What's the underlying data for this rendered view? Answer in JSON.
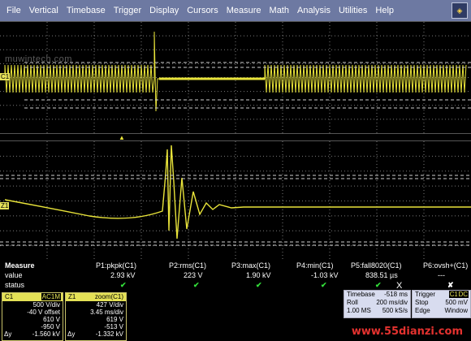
{
  "menu": [
    "File",
    "Vertical",
    "Timebase",
    "Trigger",
    "Display",
    "Cursors",
    "Measure",
    "Math",
    "Analysis",
    "Utilities",
    "Help"
  ],
  "watermark": "muwintech.com",
  "channels": {
    "c1_label": "C1",
    "z1_label": "Z1",
    "trigger_marker": "▲"
  },
  "measure": {
    "title": "Measure",
    "row_labels": [
      "value",
      "status"
    ],
    "params": [
      {
        "name": "P1:pkpk(C1)",
        "value": "2.93 kV",
        "status": "✔"
      },
      {
        "name": "P2:rms(C1)",
        "value": "223 V",
        "status": "✔"
      },
      {
        "name": "P3:max(C1)",
        "value": "1.90 kV",
        "status": "✔"
      },
      {
        "name": "P4:min(C1)",
        "value": "-1.03 kV",
        "status": "✔"
      },
      {
        "name": "P5:fall8020(C1)",
        "value": "838.51 µs",
        "status": "✔"
      },
      {
        "name": "P6:ovsh+(C1)",
        "value": "---",
        "status": "✘"
      }
    ]
  },
  "c1": {
    "name": "C1",
    "coupling": "AC1M",
    "lines": [
      [
        "",
        "500 V/div"
      ],
      [
        "",
        "-40 V offset"
      ],
      [
        "",
        "610 V"
      ],
      [
        "",
        "-950 V"
      ],
      [
        "Δy",
        "-1.560 kV"
      ]
    ]
  },
  "z1": {
    "name": "Z1",
    "mode": "zoom(C1)",
    "lines": [
      [
        "",
        "427 V/div"
      ],
      [
        "",
        "3.45 ms/div"
      ],
      [
        "",
        "619 V"
      ],
      [
        "",
        "-513 V"
      ],
      [
        "Δy",
        "-1.332 kV"
      ]
    ]
  },
  "timebase": {
    "label": "Timebase",
    "pos": "-518 ms",
    "mode": "Roll",
    "rate_time": "200 ms/div",
    "samples": "1.00 MS",
    "rate": "500 kS/s"
  },
  "trigger": {
    "label": "Trigger",
    "ch": "C1",
    "type": "DC",
    "mode": "Stop",
    "level": "500 mV",
    "kind": "Edge",
    "win": "Window"
  },
  "close_label": "X",
  "site": "www.55dianzi.com",
  "colors": {
    "trace": "#e9e43a",
    "grid": "#7a7a7a",
    "menubar": "#6d79a2",
    "check": "#33e03a",
    "cross": "#ffffff"
  }
}
